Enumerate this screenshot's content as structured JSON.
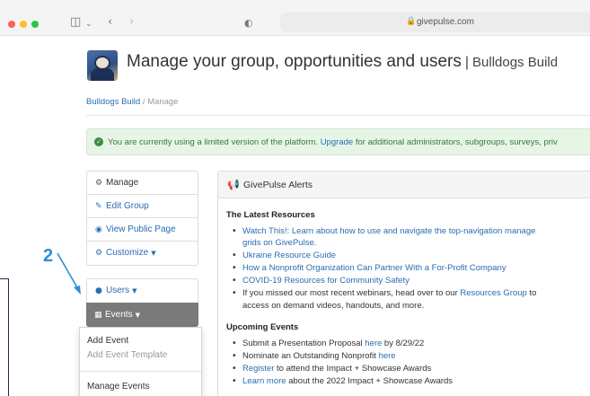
{
  "browser": {
    "url": "givepulse.com"
  },
  "header": {
    "title": "Manage your group, opportunities and users",
    "separator": "|",
    "group": "Bulldogs Build"
  },
  "breadcrumb": {
    "home": "Bulldogs Build",
    "sep": " / ",
    "current": "Manage"
  },
  "alert": {
    "before": "You are currently using a limited version of the platform.",
    "link": "Upgrade",
    "after": "for additional administrators, subgroups, surveys, priv"
  },
  "sidebar": {
    "items": [
      {
        "label": "Manage",
        "icon": "cogs-icon"
      },
      {
        "label": "Edit Group",
        "icon": "pencil-icon"
      },
      {
        "label": "View Public Page",
        "icon": "eye-icon"
      },
      {
        "label": "Customize",
        "icon": "cogs-icon"
      }
    ],
    "users": "Users",
    "events": "Events",
    "dropdown": {
      "add_event": "Add Event",
      "add_event_template": "Add Event Template",
      "manage_events": "Manage Events"
    }
  },
  "annotation": {
    "number": "2",
    "color": "#2a8fd6"
  },
  "panel": {
    "title": "GivePulse Alerts",
    "resources_title": "The Latest Resources",
    "resources": {
      "r1a": "Watch This!: Learn about how to use and navigate the top-navigation manage",
      "r1b": "grids on GivePulse.",
      "r2": "Ukraine Resource Guide",
      "r3": "How a Nonprofit Organization Can Partner With a For-Profit Company",
      "r4": "COVID-19 Resources for Community Safety",
      "r5_before": "If you missed our most recent webinars, head over to our",
      "r5_link": "Resources Group",
      "r5_after": "to",
      "r5b": "access on demand videos, handouts, and more."
    },
    "events_title": "Upcoming Events",
    "events": {
      "e1_before": "Submit a Presentation Proposal",
      "e1_link": "here",
      "e1_after": "by 8/29/22",
      "e2_before": "Nominate an Outstanding Nonprofit",
      "e2_link": "here",
      "e3_link": "Register",
      "e3_after": "to attend the Impact + Showcase Awards",
      "e4_link": "Learn more",
      "e4_after": "about the 2022 Impact + Showcase Awards"
    }
  },
  "colors": {
    "link": "#2a6db0",
    "alert_bg": "#e7f5e7",
    "alert_text": "#3c763d",
    "events_bg": "#7a7a7a"
  }
}
